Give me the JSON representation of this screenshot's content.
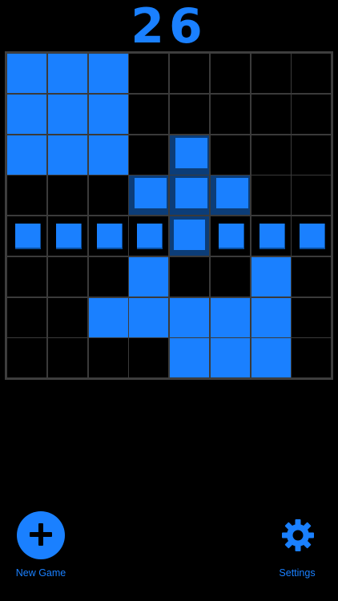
{
  "score": "26",
  "colors": {
    "accent": "#1a80ff",
    "preview": "#0c3d78",
    "grid_line": "#3a3a3a",
    "background": "#000000"
  },
  "board": {
    "rows": 8,
    "cols": 8,
    "cells": [
      [
        "filled",
        "filled",
        "filled",
        "empty",
        "empty",
        "empty",
        "empty",
        "empty"
      ],
      [
        "filled",
        "filled",
        "filled",
        "empty",
        "empty",
        "empty",
        "empty",
        "empty"
      ],
      [
        "filled",
        "filled",
        "filled",
        "empty",
        "preview-piece",
        "empty",
        "empty",
        "empty"
      ],
      [
        "empty",
        "empty",
        "empty",
        "preview-piece",
        "preview-piece",
        "preview-piece",
        "empty",
        "empty"
      ],
      [
        "clear-small",
        "clear-small",
        "clear-small",
        "clear-small",
        "clear-big",
        "clear-small",
        "clear-small",
        "clear-small"
      ],
      [
        "empty",
        "empty",
        "empty",
        "filled",
        "empty",
        "empty",
        "filled",
        "empty"
      ],
      [
        "empty",
        "empty",
        "filled",
        "filled",
        "filled",
        "filled",
        "filled",
        "empty"
      ],
      [
        "empty",
        "empty",
        "empty",
        "empty",
        "filled",
        "filled",
        "filled",
        "empty"
      ]
    ]
  },
  "buttons": {
    "new_game_label": "New Game",
    "new_game_icon": "plus-circle-icon",
    "settings_label": "Settings",
    "settings_icon": "gear-icon"
  }
}
